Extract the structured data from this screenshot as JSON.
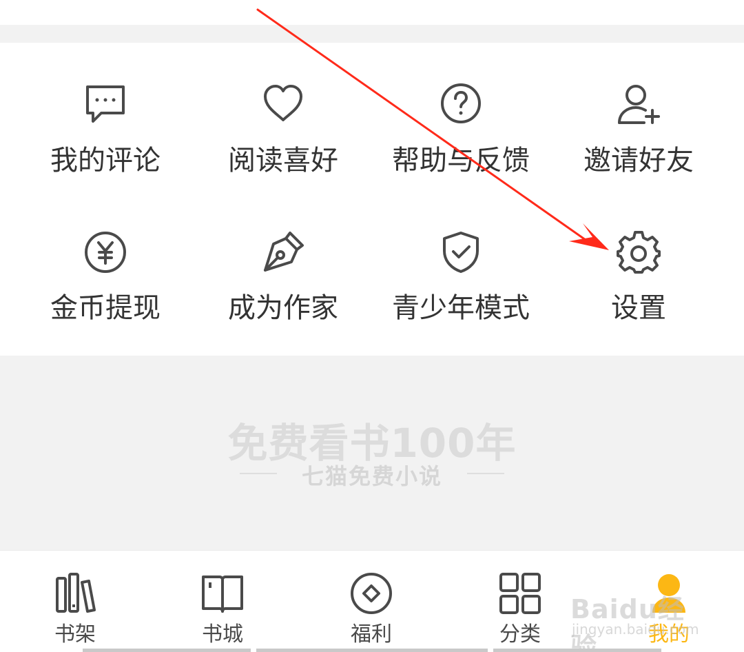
{
  "grid": {
    "row1": [
      {
        "label": "我的评论",
        "icon": "comment-icon"
      },
      {
        "label": "阅读喜好",
        "icon": "heart-icon"
      },
      {
        "label": "帮助与反馈",
        "icon": "help-icon"
      },
      {
        "label": "邀请好友",
        "icon": "add-friend-icon"
      }
    ],
    "row2": [
      {
        "label": "金币提现",
        "icon": "coin-yen-icon"
      },
      {
        "label": "成为作家",
        "icon": "pen-icon"
      },
      {
        "label": "青少年模式",
        "icon": "shield-check-icon"
      },
      {
        "label": "设置",
        "icon": "gear-icon"
      }
    ]
  },
  "slogan": {
    "title": "免费看书100年",
    "subtitle": "七猫免费小说"
  },
  "bottom_nav": {
    "items": [
      {
        "label": "书架",
        "icon": "bookshelf-icon"
      },
      {
        "label": "书城",
        "icon": "book-open-icon"
      },
      {
        "label": "福利",
        "icon": "coin-diamond-icon"
      },
      {
        "label": "分类",
        "icon": "grid-icon"
      },
      {
        "label": "我的",
        "icon": "user-icon",
        "active": true
      }
    ]
  },
  "watermark": {
    "logo": "Baidu经验",
    "url": "jingyan.baidu.com"
  },
  "colors": {
    "accent": "#fcb714",
    "arrow": "#ff2a1a",
    "icon": "#4a4a4a",
    "text": "#333333"
  }
}
